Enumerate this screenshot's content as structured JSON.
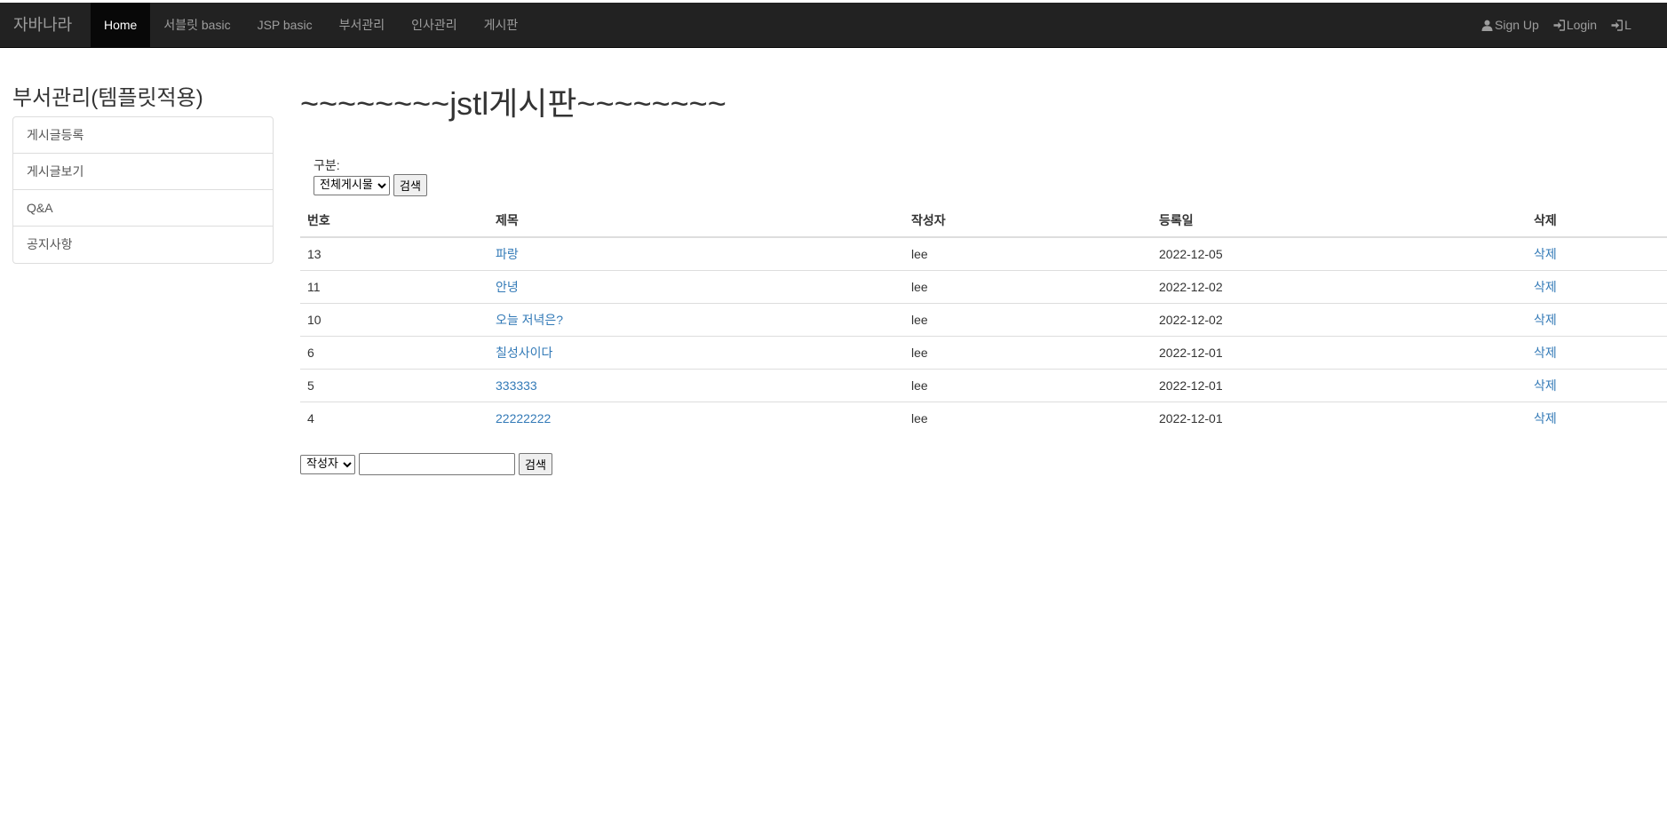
{
  "navbar": {
    "brand": "자바나라",
    "items": [
      {
        "label": "Home",
        "active": true
      },
      {
        "label": "서블릿 basic"
      },
      {
        "label": "JSP basic"
      },
      {
        "label": "부서관리"
      },
      {
        "label": "인사관리"
      },
      {
        "label": "게시판"
      }
    ],
    "right": [
      {
        "label": "Sign Up",
        "icon": "user-icon"
      },
      {
        "label": "Login",
        "icon": "login-icon"
      },
      {
        "label": "L",
        "icon": "login-icon"
      }
    ]
  },
  "sidebar": {
    "title": "부서관리(템플릿적용)",
    "items": [
      {
        "label": "게시글등록"
      },
      {
        "label": "게시글보기"
      },
      {
        "label": "Q&A"
      },
      {
        "label": "공지사항"
      }
    ]
  },
  "main": {
    "title": "~~~~~~~~jstl게시판~~~~~~~~",
    "filter": {
      "label": "구분:",
      "selected": "전체게시물",
      "button": "검색"
    },
    "table": {
      "headers": [
        "번호",
        "제목",
        "작성자",
        "등록일",
        "삭제"
      ],
      "rows": [
        {
          "no": "13",
          "title": "파랑",
          "writer": "lee",
          "date": "2022-12-05",
          "del": "삭제"
        },
        {
          "no": "11",
          "title": "안녕",
          "writer": "lee",
          "date": "2022-12-02",
          "del": "삭제"
        },
        {
          "no": "10",
          "title": "오늘 저녁은?",
          "writer": "lee",
          "date": "2022-12-02",
          "del": "삭제"
        },
        {
          "no": "6",
          "title": "칠성사이다",
          "writer": "lee",
          "date": "2022-12-01",
          "del": "삭제"
        },
        {
          "no": "5",
          "title": "333333",
          "writer": "lee",
          "date": "2022-12-01",
          "del": "삭제"
        },
        {
          "no": "4",
          "title": "22222222",
          "writer": "lee",
          "date": "2022-12-01",
          "del": "삭제"
        }
      ]
    },
    "search": {
      "selected": "작성자",
      "value": "",
      "button": "검색"
    }
  },
  "colors": {
    "navbar_bg": "#222222",
    "nav_active_bg": "#080808",
    "link": "#337ab7"
  }
}
